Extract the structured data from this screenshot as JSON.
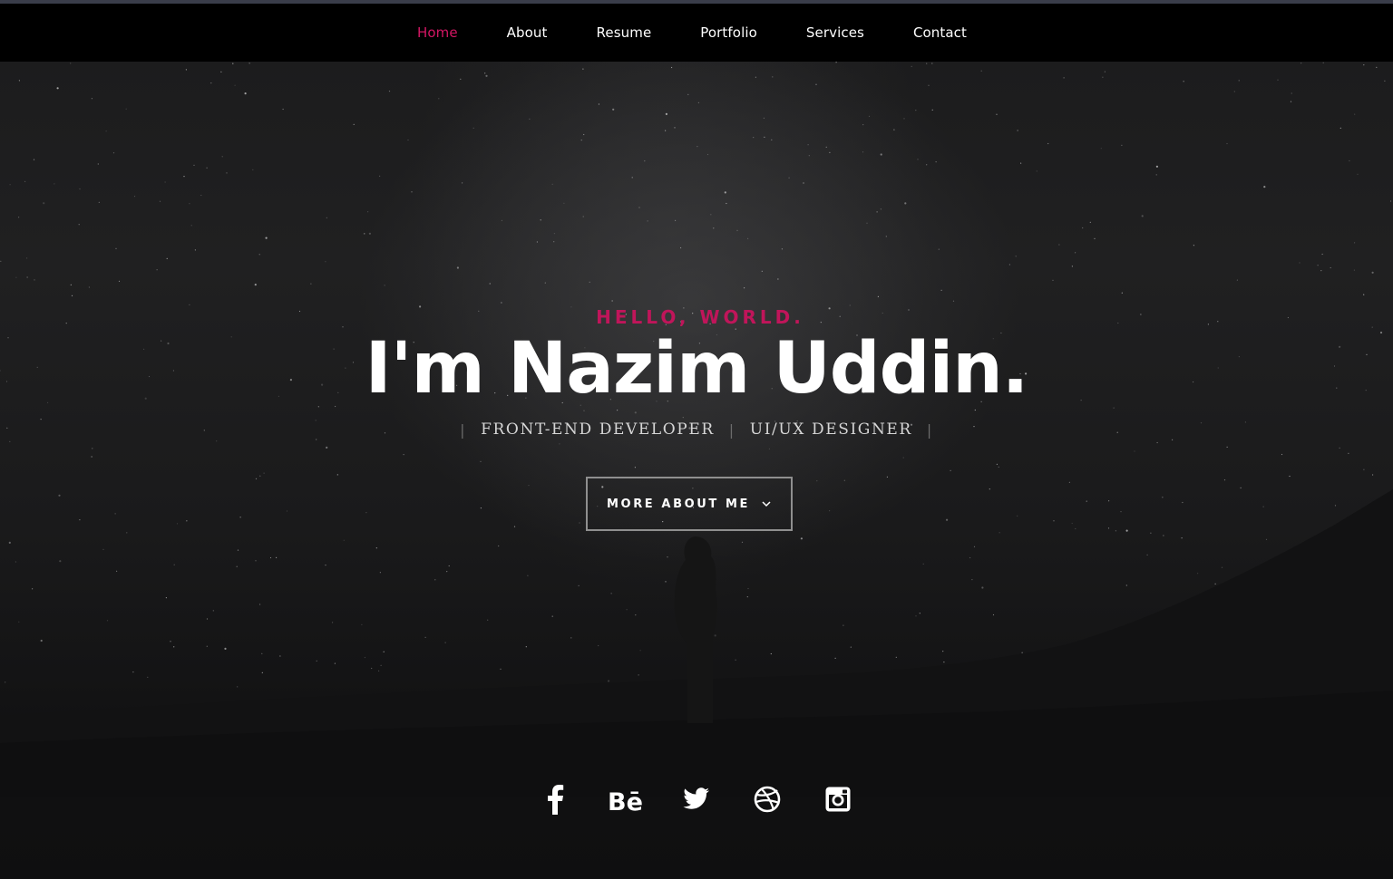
{
  "nav": {
    "items": [
      {
        "label": "Home",
        "active": true
      },
      {
        "label": "About"
      },
      {
        "label": "Resume"
      },
      {
        "label": "Portfolio"
      },
      {
        "label": "Services"
      },
      {
        "label": "Contact"
      }
    ]
  },
  "hero": {
    "greeting": "HELLO, WORLD.",
    "name": "I'm Nazim Uddin.",
    "roles": [
      "FRONT-END DEVELOPER",
      "UI/UX DESIGNER"
    ],
    "cta_label": "MORE ABOUT ME"
  },
  "social": {
    "icons": [
      "facebook-icon",
      "behance-icon",
      "twitter-icon",
      "dribbble-icon",
      "instagram-icon"
    ]
  },
  "colors": {
    "accent": "#d21663",
    "nav_bg": "#000000",
    "page_bg": "#0d0d0e"
  }
}
